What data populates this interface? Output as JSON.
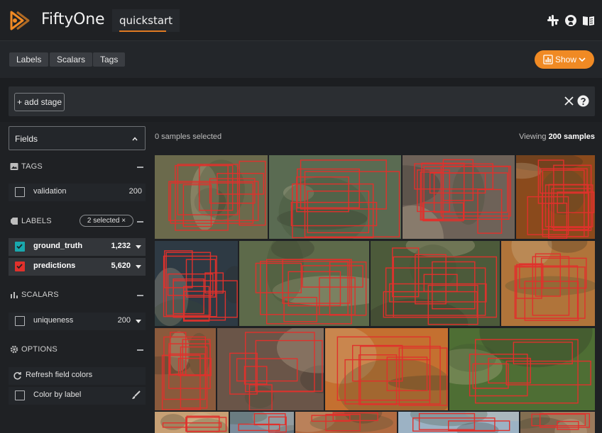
{
  "header": {
    "brand": "FiftyOne",
    "dataset_name": "quickstart",
    "icons": [
      "slack-icon",
      "github-icon",
      "docs-book-icon"
    ]
  },
  "toolbar": {
    "tabs": [
      "Labels",
      "Scalars",
      "Tags"
    ],
    "show_label": "Show"
  },
  "viewbar": {
    "add_stage_label": "+ add stage"
  },
  "sidebar": {
    "fields_label": "Fields",
    "tags": {
      "title": "TAGS",
      "rows": [
        {
          "label": "validation",
          "count": "200"
        }
      ]
    },
    "labels": {
      "title": "LABELS",
      "selected_chip": "2 selected ×",
      "rows": [
        {
          "label": "ground_truth",
          "count": "1,232",
          "color": "#19a8ad"
        },
        {
          "label": "predictions",
          "count": "5,620",
          "color": "#e0312c"
        }
      ]
    },
    "scalars": {
      "title": "SCALARS",
      "rows": [
        {
          "label": "uniqueness",
          "count": "200"
        }
      ]
    },
    "options": {
      "title": "OPTIONS",
      "refresh_label": "Refresh field colors",
      "color_by_label": "Color by label"
    }
  },
  "grid": {
    "samples_selected": "0 samples selected",
    "viewing_prefix": "Viewing ",
    "viewing_count": "200 samples",
    "tiles": [
      {
        "name": "tile-turkey",
        "bg": "#6b6a4c"
      },
      {
        "name": "tile-horse-rider",
        "bg": "#5a6b52"
      },
      {
        "name": "tile-cats",
        "bg": "#6e6258"
      },
      {
        "name": "tile-dinner-table",
        "bg": "#8a4a1c"
      },
      {
        "name": "tile-cake",
        "bg": "#2e3a44"
      },
      {
        "name": "tile-train",
        "bg": "#5d6a4a"
      },
      {
        "name": "tile-cow",
        "bg": "#4c5a3a"
      },
      {
        "name": "tile-orange-cat",
        "bg": "#b0743a"
      },
      {
        "name": "tile-man-tie",
        "bg": "#8a5a3c"
      },
      {
        "name": "tile-cat-bowl",
        "bg": "#6a5548"
      },
      {
        "name": "tile-food-grill",
        "bg": "#c47030"
      },
      {
        "name": "tile-dogs",
        "bg": "#4e6e34"
      },
      {
        "name": "tile-bear",
        "bg": "#c7a074"
      },
      {
        "name": "tile-bottom-2",
        "bg": "#7a8c9c"
      },
      {
        "name": "tile-bottom-3",
        "bg": "#b06a40"
      },
      {
        "name": "tile-bottom-4",
        "bg": "#9cb2c4"
      },
      {
        "name": "tile-bottom-5",
        "bg": "#9a7a5c"
      }
    ]
  },
  "colors": {
    "accent": "#f08a24",
    "ground_truth": "#19a8ad",
    "predictions": "#e0312c"
  }
}
